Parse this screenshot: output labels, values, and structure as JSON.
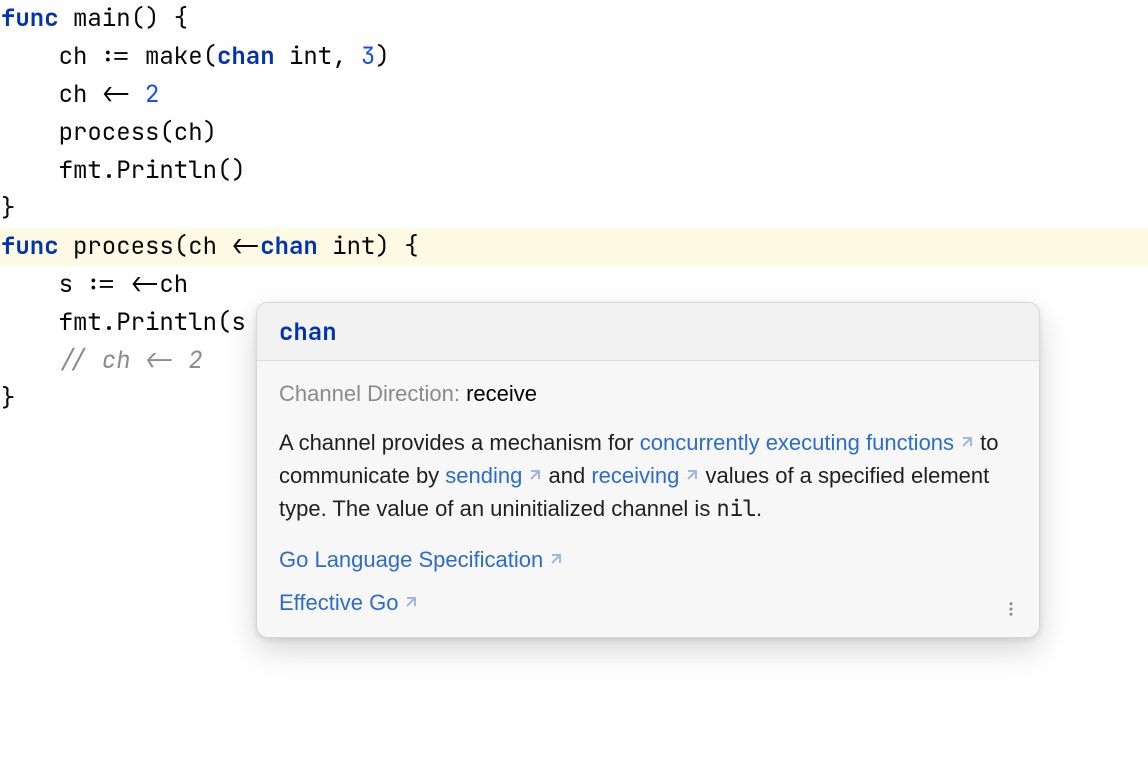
{
  "code": {
    "kw_func": "func",
    "kw_chan": "chan",
    "main_sig_open": " main() {",
    "line2_a": "    ch := make(",
    "line2_b": " int, ",
    "line2_num": "3",
    "line2_c": ")",
    "line3_a": "    ch <- ",
    "line3_num": "2",
    "line4": "    process(ch)",
    "line5": "    fmt.Println()",
    "line6": "}",
    "line7_a": " process(ch <-",
    "line7_b": " int) {",
    "line8": "    s := <-ch",
    "line9": "    fmt.Println(s",
    "line10": "    // ch <- 2",
    "line11": "}"
  },
  "popup": {
    "title": "chan",
    "dir_label": "Channel Direction:",
    "dir_value": "receive",
    "desc_1": "A channel provides a mechanism for ",
    "link_conc": "concurrently executing functions",
    "desc_2": " to communicate by ",
    "link_send": "sending",
    "desc_3": " and ",
    "link_recv": "receiving",
    "desc_4": " values of a specified element type. The value of an uninitialized channel is ",
    "nil_word": "nil",
    "period": ".",
    "ref_spec": "Go Language Specification",
    "ref_eff": "Effective Go"
  }
}
